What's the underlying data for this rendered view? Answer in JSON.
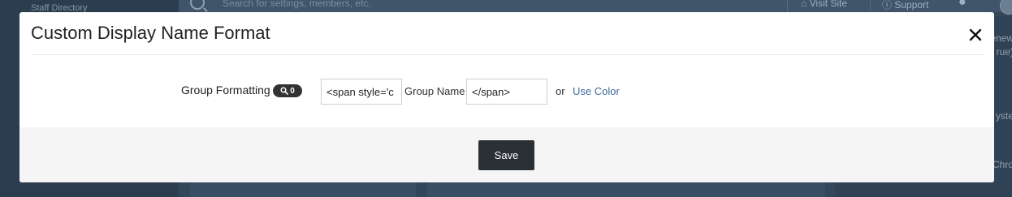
{
  "background": {
    "sidebar_label": "Staff Directory",
    "search_placeholder": "Search for settings, members, etc.",
    "top_links": {
      "visit_site": "Visit Site",
      "support": "Support"
    },
    "right_panel_fragments": [
      "enew",
      "rue)",
      "yste",
      "Chro"
    ]
  },
  "modal": {
    "title": "Custom Display Name Format",
    "close_icon": "close-icon",
    "form": {
      "label": "Group Formatting",
      "badge_icon": "search-icon",
      "badge_count": "0",
      "open_tag_value": "<span style='c",
      "group_name_text": "Group Name",
      "close_tag_value": "</span>",
      "or_text": "or",
      "use_color_link": "Use Color"
    },
    "footer": {
      "save_label": "Save"
    }
  },
  "colors": {
    "overlay": "#33475b",
    "link": "#3d6b99",
    "badge": "#333333",
    "save_button": "#2b2f36"
  }
}
